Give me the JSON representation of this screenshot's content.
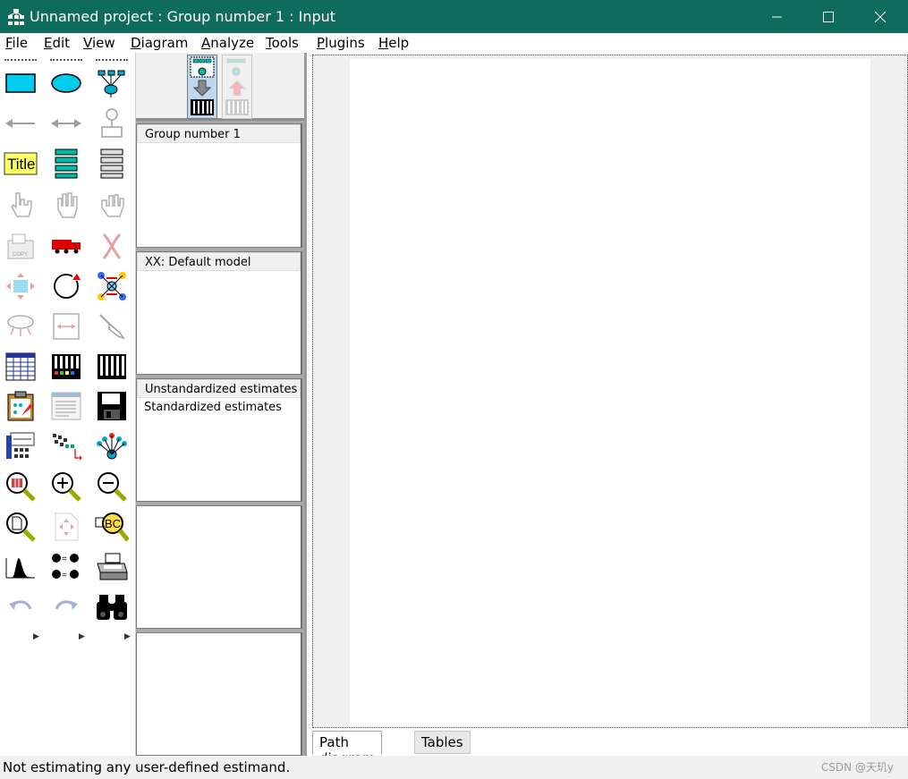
{
  "window": {
    "title": "Unnamed project : Group number 1 : Input",
    "controls": [
      "minimize-icon",
      "maximize-icon",
      "close-icon"
    ],
    "titlebar_color": "#0f6b5c"
  },
  "menu": [
    {
      "label": "File",
      "accel": "F",
      "rest": "ile"
    },
    {
      "label": "Edit",
      "accel": "E",
      "rest": "dit"
    },
    {
      "label": "View",
      "accel": "V",
      "rest": "iew"
    },
    {
      "label": "Diagram",
      "accel": "D",
      "rest": "iagram"
    },
    {
      "label": "Analyze",
      "accel": "A",
      "rest": "nalyze"
    },
    {
      "label": "Tools",
      "accel": "T",
      "rest": "ools"
    },
    {
      "label": "Plugins",
      "accel": "P",
      "rest": "lugins"
    },
    {
      "label": "Help",
      "accel": "H",
      "rest": "elp"
    }
  ],
  "toolbar": {
    "title_tool_label": "Title",
    "tools": [
      "draw-observed-variable-icon",
      "draw-unobserved-variable-icon",
      "draw-latent-with-indicators-icon",
      "draw-path-icon",
      "draw-covariance-icon",
      "add-unique-variable-icon",
      "figure-caption-icon",
      "list-variables-in-model-icon",
      "list-variables-in-dataset-icon",
      "select-one-object-icon",
      "select-all-objects-icon",
      "deselect-all-objects-icon",
      "duplicate-objects-icon",
      "move-objects-icon",
      "erase-objects-icon",
      "change-shape-icon",
      "rotate-indicators-icon",
      "reflect-indicators-icon",
      "move-parameter-icon",
      "scroll-icon",
      "touch-up-icon",
      "select-data-files-icon",
      "analysis-properties-icon",
      "calculate-estimates-icon",
      "copy-to-clipboard-icon",
      "view-text-icon",
      "save-diagram-icon",
      "object-properties-icon",
      "drag-properties-icon",
      "preserve-symmetries-icon",
      "zoom-in-area-icon",
      "zoom-in-icon",
      "zoom-out-icon",
      "zoom-page-icon",
      "fit-to-page-icon",
      "loupe-icon",
      "bayesian-estimation-icon",
      "multiple-group-analysis-icon",
      "print-icon",
      "undo-icon",
      "redo-icon",
      "specification-search-icon"
    ]
  },
  "mode_buttons": [
    "view-input-path-diagram-icon",
    "view-output-path-diagram-icon"
  ],
  "panels": {
    "groups": [
      "Group number 1"
    ],
    "models": [
      "XX: Default model"
    ],
    "estimates": [
      "Unstandardized estimates",
      "Standardized estimates"
    ]
  },
  "tabs": [
    "Path diagram",
    "Tables"
  ],
  "status": {
    "text": "Not estimating any user-defined estimand.",
    "watermark": "CSDN @天玑y"
  }
}
